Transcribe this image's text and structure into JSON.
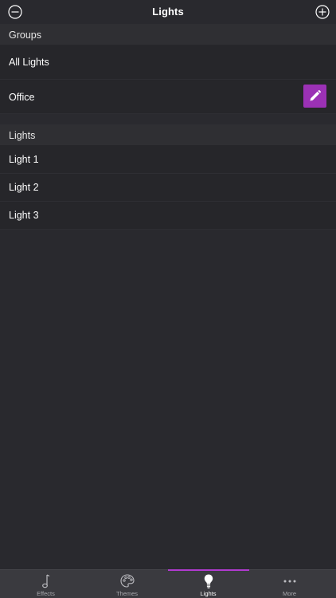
{
  "navbar": {
    "title": "Lights",
    "left_icon": "minus-circle-icon",
    "right_icon": "plus-circle-icon"
  },
  "groups": {
    "header": "Groups",
    "items": [
      {
        "label": "All Lights"
      },
      {
        "label": "Office",
        "action_icon": "pencil-icon"
      }
    ]
  },
  "lights": {
    "header": "Lights",
    "items": [
      {
        "label": "Light 1"
      },
      {
        "label": "Light 2"
      },
      {
        "label": "Light 3"
      }
    ]
  },
  "tabbar": {
    "active": "Lights",
    "tabs": [
      {
        "label": "Effects",
        "icon": "music-note-icon"
      },
      {
        "label": "Themes",
        "icon": "palette-icon"
      },
      {
        "label": "Lights",
        "icon": "lightbulb-icon"
      },
      {
        "label": "More",
        "icon": "more-dots-icon"
      }
    ]
  },
  "colors": {
    "accent": "#9b31b5",
    "background": "#29292e",
    "tab_indicator": "#b13ad0"
  }
}
